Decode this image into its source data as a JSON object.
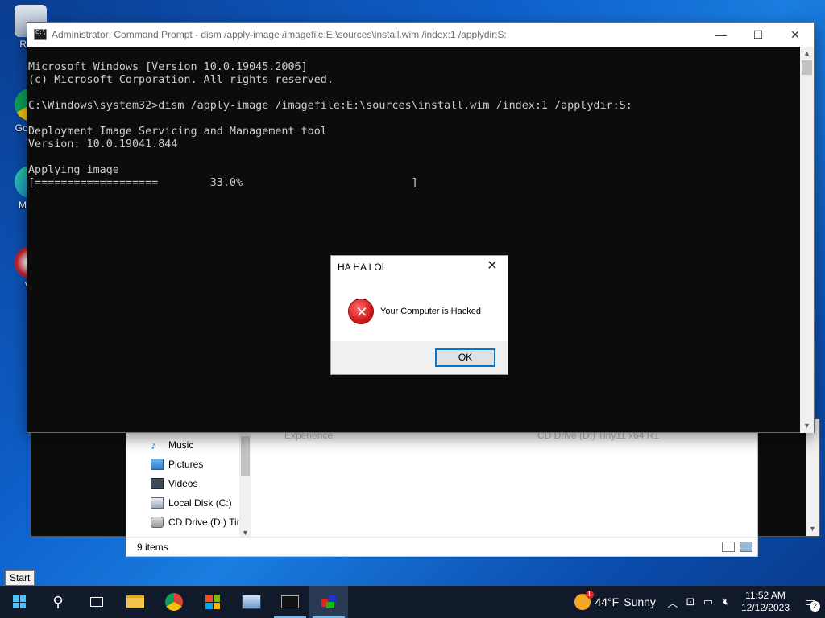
{
  "desktop": {
    "icons": [
      {
        "label": "Recy"
      },
      {
        "label": "Go Chr"
      },
      {
        "label": "Mic E"
      },
      {
        "label": "Vir"
      }
    ]
  },
  "cmd": {
    "title": "Administrator: Command Prompt - dism  /apply-image /imagefile:E:\\sources\\install.wim /index:1 /applydir:S:",
    "lines": [
      "Microsoft Windows [Version 10.0.19045.2006]",
      "(c) Microsoft Corporation. All rights reserved.",
      "",
      "C:\\Windows\\system32>dism /apply-image /imagefile:E:\\sources\\install.wim /index:1 /applydir:S:",
      "",
      "Deployment Image Servicing and Management tool",
      "Version: 10.0.19041.844",
      "",
      "Applying image",
      "[===================        33.0%                          ]"
    ],
    "minimize_glyph": "—",
    "maximize_glyph": "☐",
    "close_glyph": "✕"
  },
  "explorer": {
    "nav_items": [
      {
        "label": "Music",
        "icon": "music-icon"
      },
      {
        "label": "Pictures",
        "icon": "pictures-icon"
      },
      {
        "label": "Videos",
        "icon": "videos-icon"
      },
      {
        "label": "Local Disk (C:)",
        "icon": "local-disk-icon"
      },
      {
        "label": "CD Drive (D:) Tin",
        "icon": "cd-drive-icon"
      }
    ],
    "status": "9 items",
    "ghost_file": "Experience",
    "ghost_location": "CD Drive (D:) Tiny11 x64 R1"
  },
  "msgbox": {
    "title": "HA HA LOL",
    "message": "Your Computer is Hacked",
    "ok_label": "OK"
  },
  "tooltip": "Start",
  "taskbar": {
    "weather_temp": "44°F",
    "weather_desc": "Sunny",
    "time": "11:52 AM",
    "date": "12/12/2023",
    "notif_count": "2"
  },
  "colors": {
    "accent": "#0078d7",
    "console_bg": "#0c0c0c",
    "console_fg": "#cccccc",
    "taskbar_bg": "#101a2a"
  }
}
